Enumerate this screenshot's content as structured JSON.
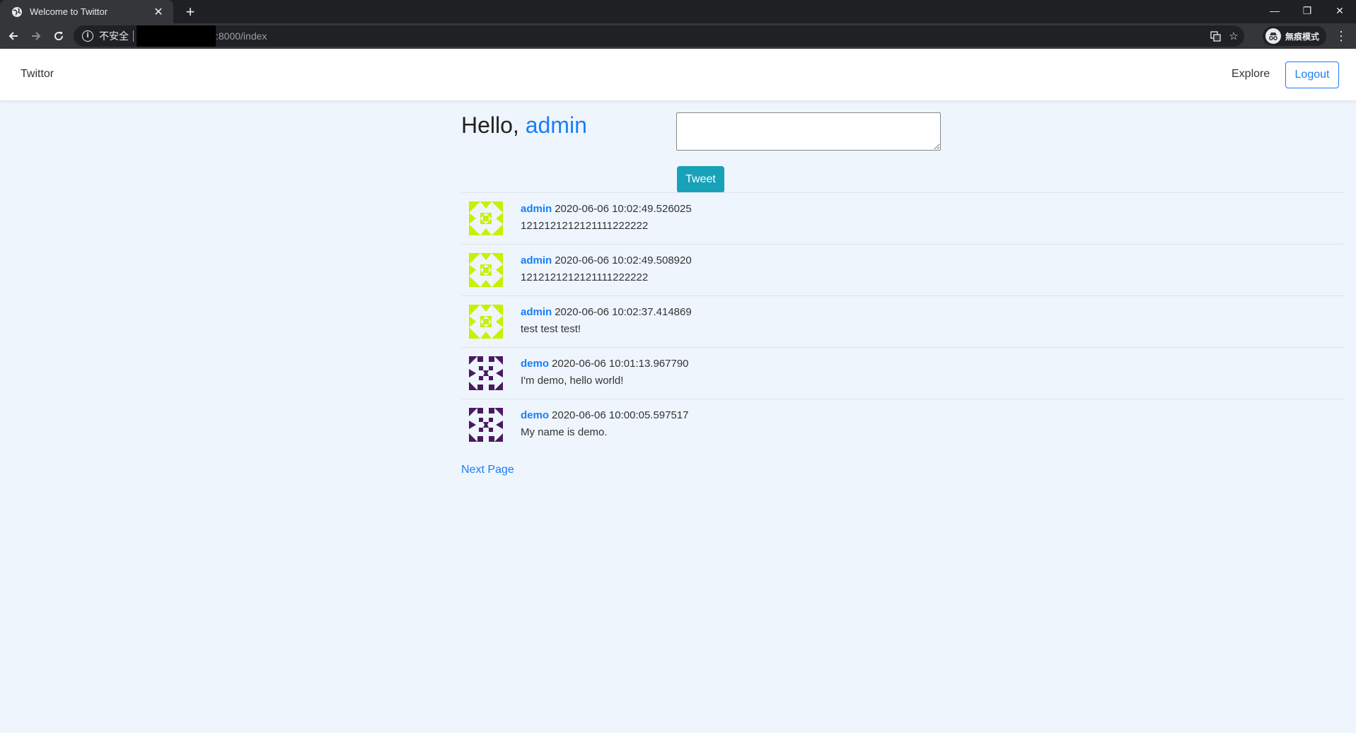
{
  "browser": {
    "tab_title": "Welcome to Twittor",
    "tab_close": "✕",
    "new_tab": "+",
    "security_label": "不安全",
    "url": ":8000/index",
    "incognito_label": "無痕模式",
    "window_buttons": {
      "minimize": "—",
      "restore": "❐",
      "close": "✕"
    }
  },
  "navbar": {
    "brand": "Twittor",
    "explore": "Explore",
    "logout": "Logout"
  },
  "greeting": {
    "prefix": "Hello,",
    "username": "admin"
  },
  "compose": {
    "tweet_button": "Tweet",
    "value": ""
  },
  "feed": {
    "posts": [
      {
        "author": "admin",
        "timestamp": "2020-06-06 10:02:49.526025",
        "body": "1212121212121111222222",
        "avatar": "admin-identicon"
      },
      {
        "author": "admin",
        "timestamp": "2020-06-06 10:02:49.508920",
        "body": "1212121212121111222222",
        "avatar": "admin-identicon"
      },
      {
        "author": "admin",
        "timestamp": "2020-06-06 10:02:37.414869",
        "body": "test test test!",
        "avatar": "admin-identicon"
      },
      {
        "author": "demo",
        "timestamp": "2020-06-06 10:01:13.967790",
        "body": "I'm demo, hello world!",
        "avatar": "demo-identicon"
      },
      {
        "author": "demo",
        "timestamp": "2020-06-06 10:00:05.597517",
        "body": "My name is demo.",
        "avatar": "demo-identicon"
      }
    ],
    "next_page": "Next Page"
  },
  "colors": {
    "accent": "#1a7ef7",
    "tweet_button": "#17a2b8",
    "page_bg": "#eef5fd",
    "admin_avatar": "#c8f000",
    "demo_avatar": "#4a1a5e"
  }
}
